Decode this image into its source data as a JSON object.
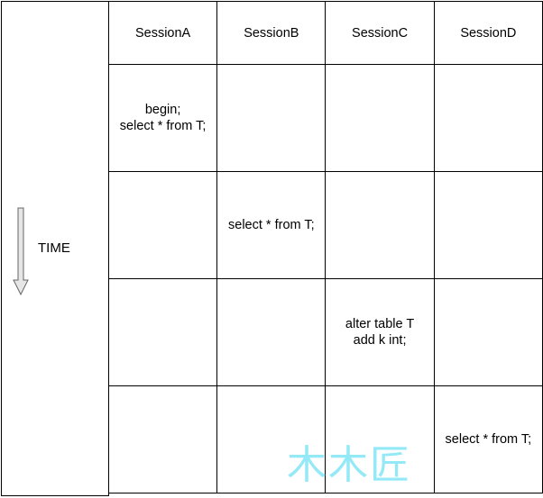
{
  "time_axis": {
    "label": "TIME",
    "arrow_direction": "down",
    "arrow_fill": "#e6e6e6",
    "arrow_stroke": "#666666"
  },
  "headers": [
    "SessionA",
    "SessionB",
    "SessionC",
    "SessionD"
  ],
  "rows": [
    [
      "begin;\nselect * from T;",
      "",
      "",
      ""
    ],
    [
      "",
      "select * from T;",
      "",
      ""
    ],
    [
      "",
      "",
      "alter table T\nadd k int;",
      ""
    ],
    [
      "",
      "",
      "",
      "select * from T;"
    ]
  ],
  "watermark": {
    "text": "木木匠",
    "color": "#8fe8f7"
  }
}
